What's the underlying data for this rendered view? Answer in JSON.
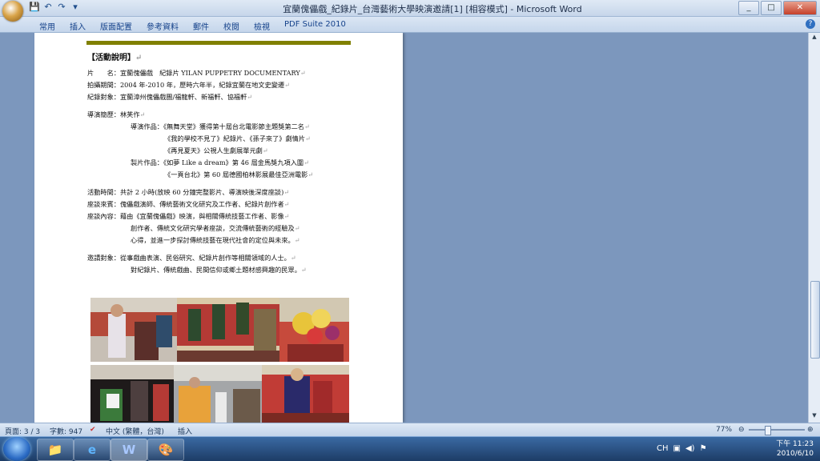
{
  "window": {
    "title": "宜蘭傀儡戲_紀錄片_台灣藝術大學映演邀請[1] [相容模式] - Microsoft Word",
    "controls": [
      "_",
      "□",
      "✕"
    ]
  },
  "qat": [
    "💾",
    "↶",
    "↷",
    "▾"
  ],
  "ribbon": {
    "tabs": [
      "常用",
      "插入",
      "版面配置",
      "參考資料",
      "郵件",
      "校閱",
      "檢視",
      "PDF Suite 2010"
    ],
    "help": "?"
  },
  "document": {
    "heading": "【活動說明】",
    "lines": [
      {
        "cls": "",
        "text": "片　　名：宜蘭傀儡戲　紀錄片 YILAN PUPPETRY DOCUMENTARY"
      },
      {
        "cls": "",
        "text": "拍攝期間：2004 年-2010 年，歷時六年半，紀錄宜蘭在地文史變遷"
      },
      {
        "cls": "",
        "text": "紀錄對象：宜蘭漳州傀儡戲團/福龍軒、新福軒、協福軒"
      },
      {
        "cls": "gap",
        "text": ""
      },
      {
        "cls": "",
        "text": "導演簡歷：林芙作"
      },
      {
        "cls": "ind",
        "text": "導演作品：《無舞天堂》獲得第十屆台北電影節主題獎第二名"
      },
      {
        "cls": "ind2",
        "text": "《我的學校不見了》紀錄片、《孫子來了》劇情片"
      },
      {
        "cls": "ind2",
        "text": "《再見夏天》公視人生劇展單元劇"
      },
      {
        "cls": "ind",
        "text": "製片作品：《如夢 Like a dream》第 46 屆金馬獎九項入圍"
      },
      {
        "cls": "ind2",
        "text": "《一頁台北》第 60 屆德國柏林影展最佳亞洲電影"
      },
      {
        "cls": "gap",
        "text": ""
      },
      {
        "cls": "",
        "text": "活動時間：共計 2 小時(放映 60 分鐘完整影片、導演映後深度座談)"
      },
      {
        "cls": "",
        "text": "座談來賓：傀儡戲演師、傳統藝術文化研究及工作者、紀錄片創作者"
      },
      {
        "cls": "",
        "text": "座談內容：藉由《宜蘭傀儡戲》映演，與相關傳統技藝工作者、影像"
      },
      {
        "cls": "ind",
        "text": "創作者、傳統文化研究學者座談，交流傳統藝術的經驗及"
      },
      {
        "cls": "ind",
        "text": "心得，並進一步探討傳統技藝在現代社會的定位與未來。"
      },
      {
        "cls": "gap",
        "text": ""
      },
      {
        "cls": "",
        "text": "邀請對象：從事戲曲表演、民俗研究、紀錄片創作等相關領域的人士。"
      },
      {
        "cls": "ind",
        "text": "對紀錄片、傳統戲曲、民間信仰或鄉土題材感興趣的民眾。"
      }
    ],
    "paragraph_mark": "↵"
  },
  "statusbar": {
    "page": "頁面: 3 / 3",
    "words": "字數: 947",
    "lang": "中文 (繁體，台灣)",
    "mode": "插入",
    "zoom": "77%",
    "zoom_minus": "⊖",
    "zoom_plus": "⊕"
  },
  "taskbar": {
    "apps": [
      "📁",
      "e",
      "W",
      "🎨"
    ],
    "time": "下午 11:23",
    "date": "2010/6/10",
    "tray_lang": "CH"
  }
}
